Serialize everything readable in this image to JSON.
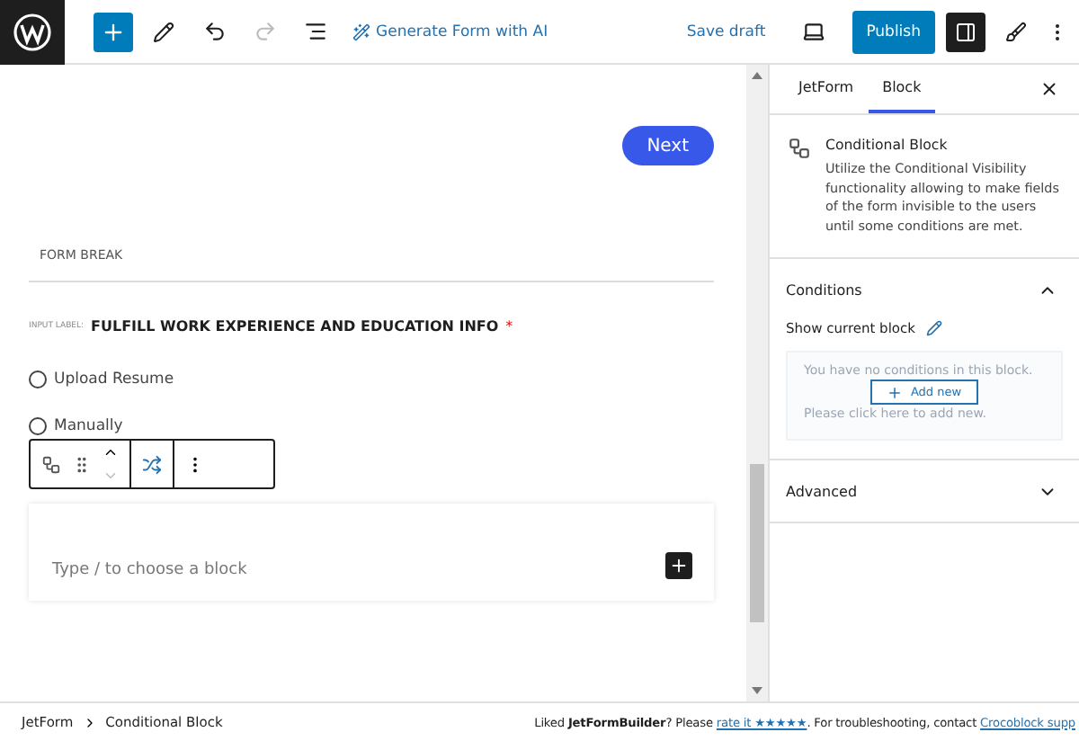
{
  "toolbar": {
    "ai_button": "Generate Form with AI",
    "save_draft": "Save draft",
    "publish": "Publish",
    "settings_open": true
  },
  "canvas": {
    "next_button": "Next",
    "form_break": "FORM BREAK",
    "input_label_tag": "INPUT LABEL:",
    "field_label": "FULFILL WORK EXPERIENCE AND EDUCATION INFO",
    "required_mark": "*",
    "options": [
      {
        "label": "Upload Resume",
        "selected": false
      },
      {
        "label": "Manually",
        "selected": false
      }
    ],
    "appender_placeholder": "Type / to choose a block"
  },
  "sidebar": {
    "tabs": [
      {
        "label": "JetForm",
        "selected": false
      },
      {
        "label": "Block",
        "selected": true
      }
    ],
    "block": {
      "title": "Conditional Block",
      "description": "Utilize the Conditional Visibility functionality allowing to make fields of the form invisible to the users until some conditions are met."
    },
    "panels": [
      {
        "kind": "conditions",
        "title": "Conditions",
        "expanded": true,
        "show_label": "Show current block",
        "empty_line_1": "You have no conditions in this block.",
        "empty_line_2": "Please click here to add new.",
        "add_button": "Add new"
      },
      {
        "kind": "advanced",
        "title": "Advanced",
        "expanded": false
      }
    ]
  },
  "breadcrumbs": [
    "JetForm",
    "Conditional Block"
  ],
  "footer": {
    "before": "Liked **JetFormBuilder**? Please ",
    "rate_link": "rate it ★★★★★",
    "middle": ". For troubleshooting, contact ",
    "support_link": "Crocoblock supp"
  }
}
